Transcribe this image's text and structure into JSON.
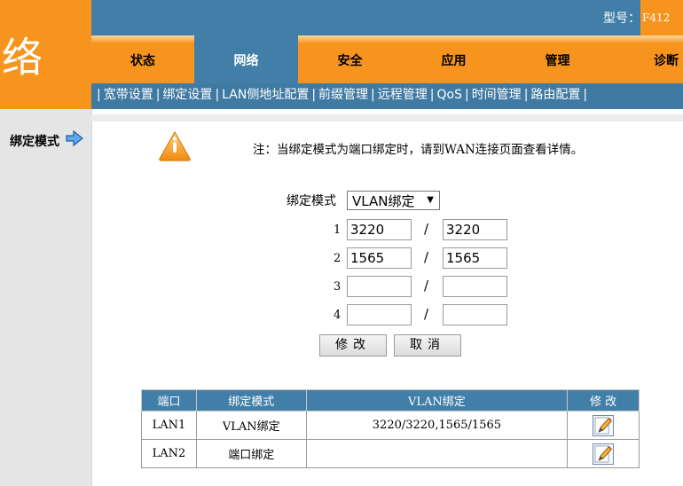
{
  "header": {
    "logo_text": "络",
    "model_label": "型号：",
    "model_value": "F412"
  },
  "main_nav": [
    {
      "label": "状态",
      "active": false
    },
    {
      "label": "网络",
      "active": true
    },
    {
      "label": "安全",
      "active": false
    },
    {
      "label": "应用",
      "active": false
    },
    {
      "label": "管理",
      "active": false
    },
    {
      "label": "诊断",
      "active": false
    }
  ],
  "sub_nav": {
    "separator": "|",
    "items": [
      "宽带设置",
      "绑定设置",
      "LAN侧地址配置",
      "前缀管理",
      "远程管理",
      "QoS",
      "时间管理",
      "路由配置"
    ],
    "active": "绑定设置"
  },
  "sidebar": {
    "label": "绑定模式",
    "arrow_icon": "arrow-right-icon"
  },
  "notice": {
    "icon": "warning-icon",
    "text": "注：当绑定模式为端口绑定时，请到WAN连接页面查看详情。"
  },
  "form": {
    "mode_label": "绑定模式",
    "mode_value": "VLAN绑定",
    "separator": "/",
    "rows": [
      {
        "num": "1",
        "left": "3220",
        "right": "3220"
      },
      {
        "num": "2",
        "left": "1565",
        "right": "1565"
      },
      {
        "num": "3",
        "left": "",
        "right": ""
      },
      {
        "num": "4",
        "left": "",
        "right": ""
      }
    ],
    "modify_button": "修改",
    "cancel_button": "取消"
  },
  "table": {
    "headers": [
      "端口",
      "绑定模式",
      "VLAN绑定",
      "修 改"
    ],
    "rows": [
      {
        "port": "LAN1",
        "mode": "VLAN绑定",
        "vlan": "3220/3220,1565/1565"
      },
      {
        "port": "LAN2",
        "mode": "端口绑定",
        "vlan": ""
      }
    ],
    "edit_icon": "edit-icon"
  },
  "colors": {
    "orange": "#f7941d",
    "blue": "#427fa8",
    "sidebar_gray": "#e5e5e5"
  }
}
